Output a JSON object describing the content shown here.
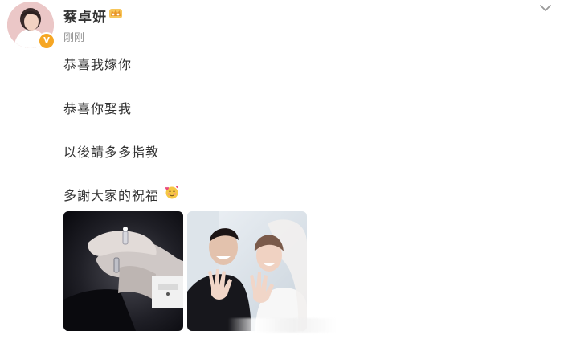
{
  "post": {
    "author": {
      "name": "蔡卓妍",
      "verified": true,
      "avatar_icon": "user-avatar-icon",
      "verified_badge_icon": "verified-v-icon",
      "verified_badge_text": "V",
      "member_badge_icon": "crown-member-icon"
    },
    "timestamp": "刚刚",
    "more_menu_icon": "chevron-down-icon",
    "lines": [
      "恭喜我嫁你",
      "恭喜你娶我",
      "以後請多多指教",
      "多謝大家的祝福"
    ],
    "line_emoji_icon": "blush-hearts-emoji-icon",
    "images": [
      {
        "icon": "wedding-ring-hands-photo"
      },
      {
        "icon": "couple-wedding-photo"
      }
    ],
    "colors": {
      "text": "#333333",
      "muted": "#939393",
      "badge": "#f6a623"
    }
  }
}
